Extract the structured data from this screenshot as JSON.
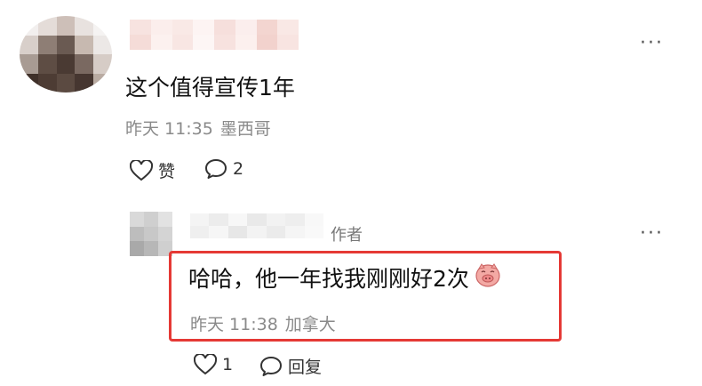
{
  "comment": {
    "text": "这个值得宣传1年",
    "time": "昨天 11:35",
    "location": "墨西哥",
    "like_label": "赞",
    "reply_count": "2",
    "more_icon": "more-dots-icon"
  },
  "reply": {
    "author_partial": "DC",
    "author_tag": "作者",
    "text": "哈哈，他一年找我刚刚好2次",
    "time": "昨天 11:38",
    "location": "加拿大",
    "like_count": "1",
    "reply_label": "回复",
    "emoji_icon": "pig-face-emoji-icon",
    "highlight_color": "#e53935"
  }
}
